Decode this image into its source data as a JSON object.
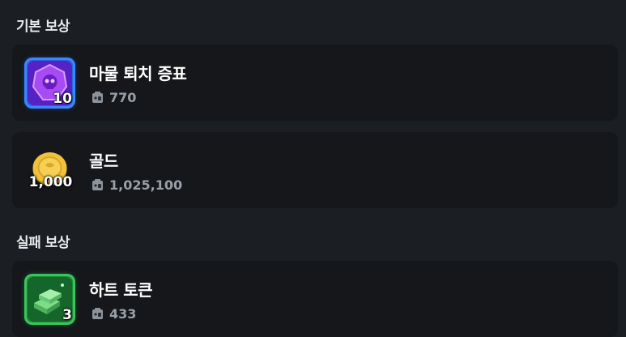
{
  "sections": {
    "basic_title": "기본 보상",
    "fail_title": "실패 보상"
  },
  "rewards": [
    {
      "name": "마물 퇴치 증표",
      "count": "10",
      "price": "770"
    },
    {
      "name": "골드",
      "count": "1,000",
      "price": "1,025,100"
    },
    {
      "name": "하트 토큰",
      "count": "3",
      "price": "433"
    }
  ],
  "colors": {
    "background": "#1b1e22",
    "card": "#15171a",
    "price_text": "#9aa0a8",
    "frame_blue": "#2a66e0",
    "frame_green": "#1f8a3a",
    "coin_gold": "#f2c13b"
  },
  "icons": {
    "token": "purple-skull-emblem-icon",
    "gold": "gold-coin-icon",
    "heart_token": "green-crystal-stack-icon",
    "price": "trade-bag-icon"
  }
}
